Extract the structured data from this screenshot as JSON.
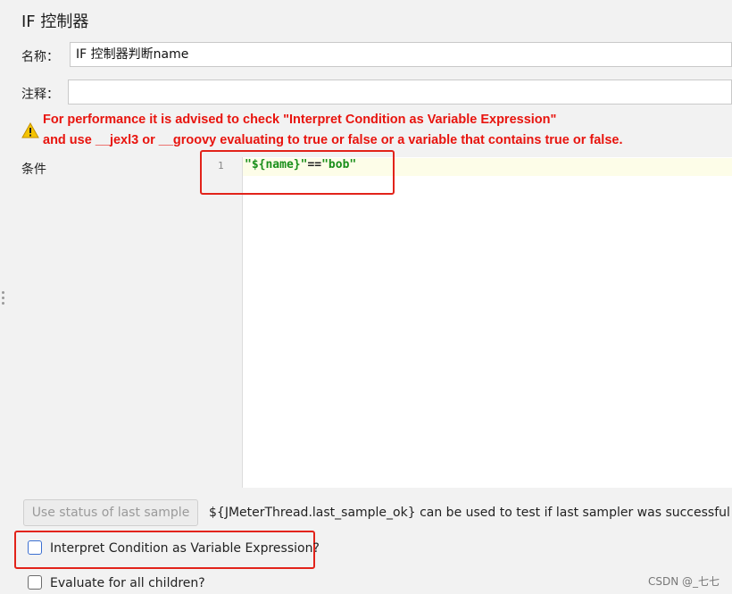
{
  "panel": {
    "title": "IF 控制器"
  },
  "form": {
    "name_label": "名称：",
    "name_value": "IF 控制器判断name",
    "comment_label": "注释：",
    "comment_value": ""
  },
  "warning": {
    "icon": "warning-triangle-icon",
    "line1": "For performance it is advised to check \"Interpret Condition as Variable Expression\"",
    "line2": "and use __jexl3 or __groovy evaluating to true or false or a variable that contains true or false."
  },
  "condition": {
    "label": "条件",
    "line_number": "1",
    "code_left": "\"${name}\"",
    "code_op": "==",
    "code_right": "\"bob\""
  },
  "actions": {
    "use_status_button": "Use status of last sample",
    "hint": "${JMeterThread.last_sample_ok} can be used to test if last sampler was successful"
  },
  "options": {
    "interpret_label": "Interpret Condition as Variable Expression?",
    "interpret_checked": false,
    "evaluate_all_label": "Evaluate for all children?",
    "evaluate_all_checked": false
  },
  "watermark": "CSDN @_七七",
  "colors": {
    "warning_red": "#e8140e",
    "highlight_box": "#e2231a",
    "code_green": "#1a8f1a"
  }
}
